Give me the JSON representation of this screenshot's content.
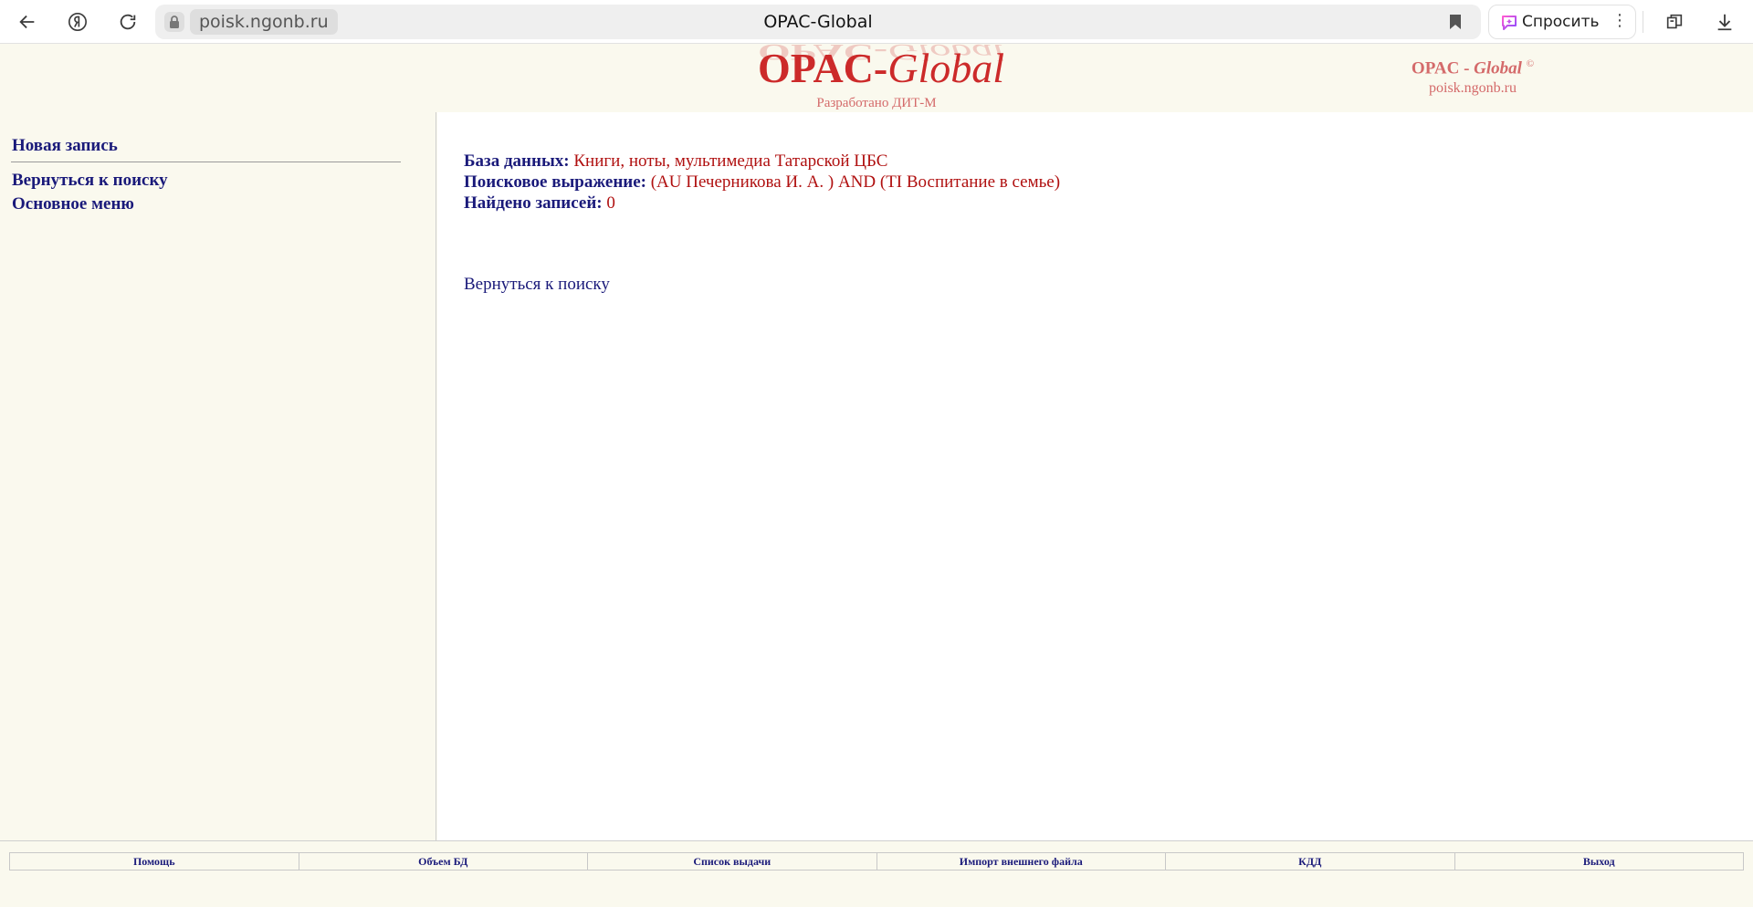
{
  "browser": {
    "domain": "poisk.ngonb.ru",
    "tab_title": "OPAC-Global",
    "ask_label": "Спросить",
    "more": "⋮",
    "icons": [
      "back-icon",
      "yandex-icon",
      "reload-icon",
      "lock-icon",
      "bookmark-icon",
      "ask-icon",
      "tabs-icon",
      "download-icon"
    ]
  },
  "header": {
    "logo_opac": "OPAC-",
    "logo_global": "Global",
    "developed_by": "Разработано ДИТ-М",
    "brand_opac": "OPAC - ",
    "brand_global": "Global",
    "brand_copyright": "©",
    "brand_domain": "poisk.ngonb.ru"
  },
  "sidebar": {
    "new_record": "Новая запись",
    "back_to_search": "Вернуться к поиску",
    "main_menu": "Основное меню"
  },
  "main": {
    "db_label": "База данных:",
    "db_value": "Книги, ноты, мультимедиа Татарской ЦБС",
    "query_label": "Поисковое выражение:",
    "query_value": "(AU Печерникова И. А. ) AND (TI Воспитание в семье)",
    "found_label": "Найдено записей:",
    "found_value": "0",
    "back_link": "Вернуться к поиску"
  },
  "footer": {
    "items": [
      "Помощь",
      "Объем БД",
      "Список выдачи",
      "Импорт внешнего файла",
      "КДД",
      "Выход"
    ]
  },
  "colors": {
    "page_bg": "#faf9ee",
    "link": "#1a1a7a",
    "value": "#b01010",
    "logo": "#cc2a2a"
  }
}
